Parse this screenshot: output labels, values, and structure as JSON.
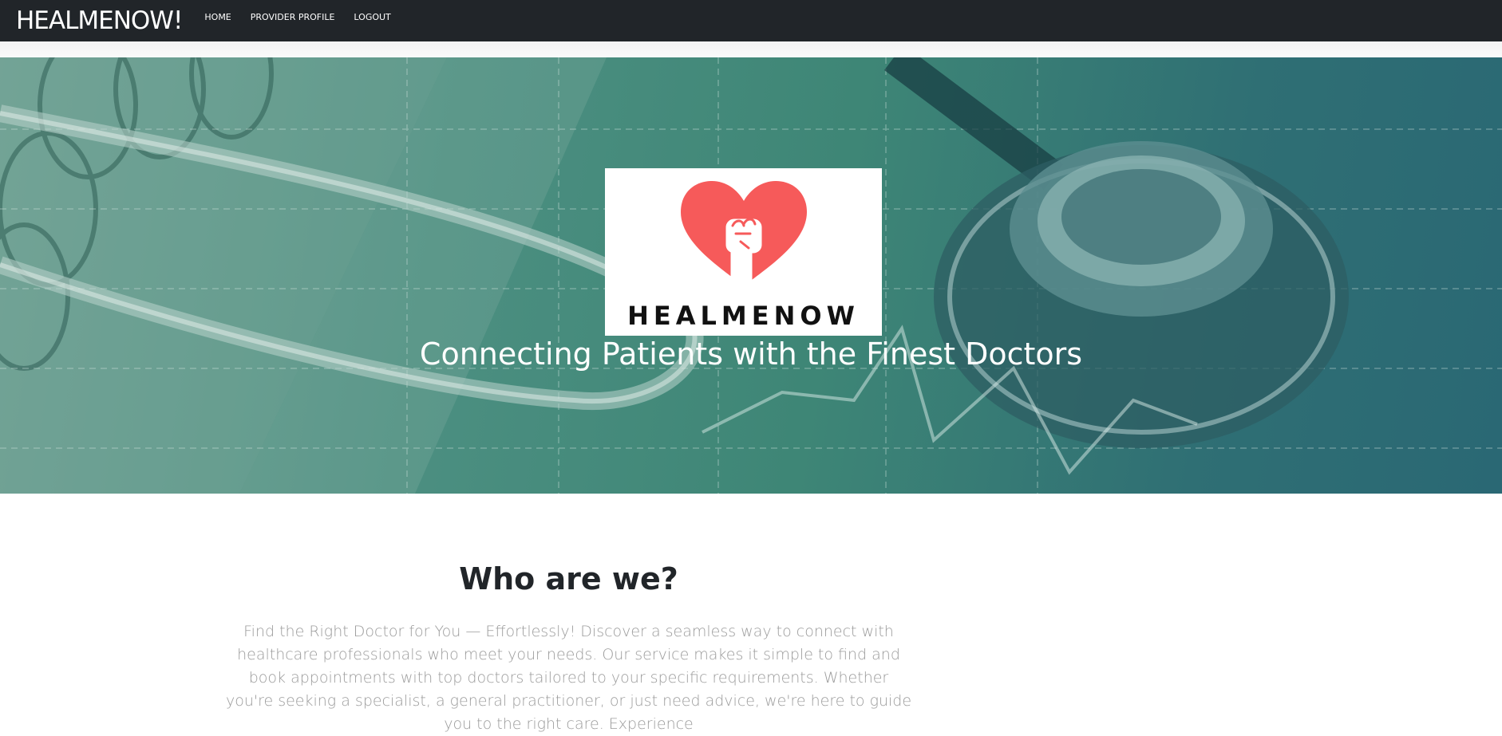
{
  "navbar": {
    "brand": "HEALMENOW!",
    "links": [
      "HOME",
      "PROVIDER PROFILE",
      "LOGOUT"
    ]
  },
  "hero": {
    "logo_text": "HEALMENOW",
    "tagline": "Connecting Patients with the Finest Doctors"
  },
  "about": {
    "heading": "Who are we?",
    "body": "Find the Right Doctor for You — Effortlessly! Discover a seamless way to connect with healthcare professionals who meet your needs. Our service makes it simple to find and book appointments with top doctors tailored to your specific requirements. Whether you're seeking a specialist, a general practitioner, or just need advice, we're here to guide you to the right care. Experience"
  },
  "colors": {
    "navbar": "#212529",
    "heart": "#f65a5a",
    "hero_teal": "#3e8676",
    "body_text": "#9b9b9b"
  },
  "icons": {
    "logo": "heart-fist-icon"
  }
}
